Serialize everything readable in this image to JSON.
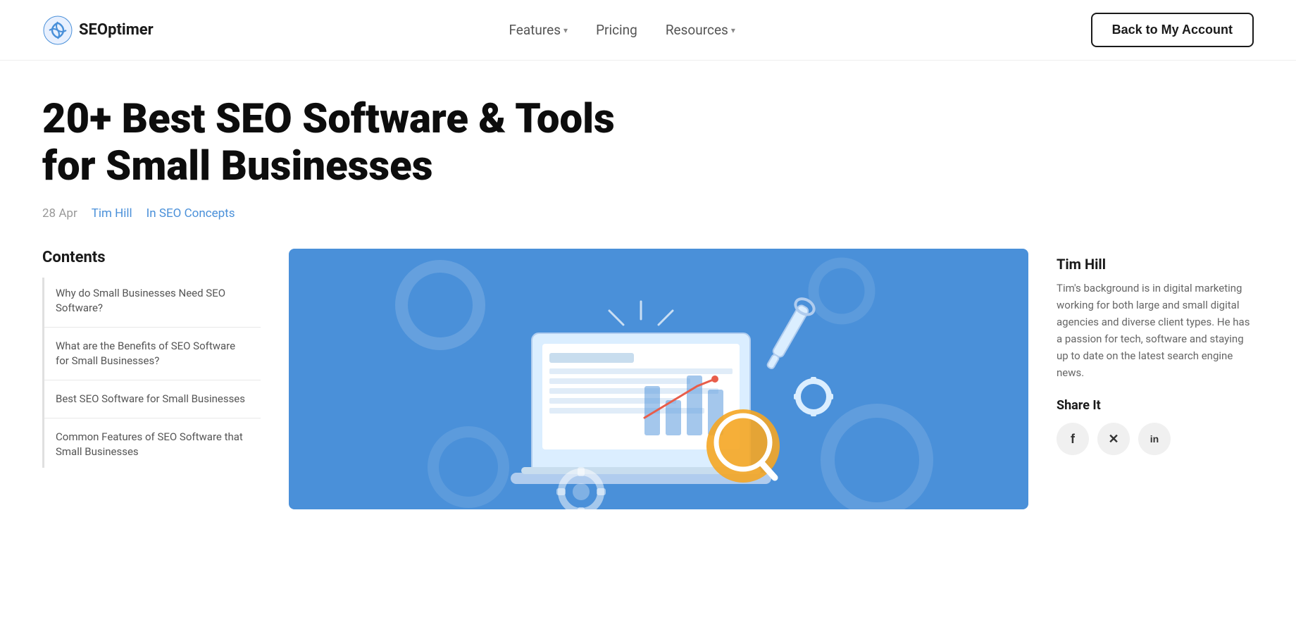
{
  "header": {
    "logo_text": "SEOptimer",
    "nav_items": [
      {
        "label": "Features",
        "has_dropdown": true
      },
      {
        "label": "Pricing",
        "has_dropdown": false
      },
      {
        "label": "Resources",
        "has_dropdown": true
      }
    ],
    "back_button_label": "Back to My Account"
  },
  "article": {
    "title": "20+ Best SEO Software & Tools for Small Businesses",
    "meta": {
      "date": "28 Apr",
      "author": "Tim Hill",
      "category": "In SEO Concepts"
    }
  },
  "toc": {
    "title": "Contents",
    "items": [
      {
        "label": "Why do Small Businesses Need SEO Software?",
        "active": false
      },
      {
        "label": "What are the Benefits of SEO Software for Small Businesses?",
        "active": false
      },
      {
        "label": "Best SEO Software for Small Businesses",
        "active": false
      },
      {
        "label": "Common Features of SEO Software that Small Businesses",
        "active": false
      }
    ]
  },
  "author": {
    "name": "Tim Hill",
    "bio": "Tim's background is in digital marketing working for both large and small digital agencies and diverse client types. He has a passion for tech, software and staying up to date on the latest search engine news.",
    "share_title": "Share It",
    "share_buttons": [
      {
        "label": "f",
        "name": "facebook"
      },
      {
        "label": "𝕏",
        "name": "twitter-x"
      },
      {
        "label": "in",
        "name": "linkedin"
      }
    ]
  }
}
